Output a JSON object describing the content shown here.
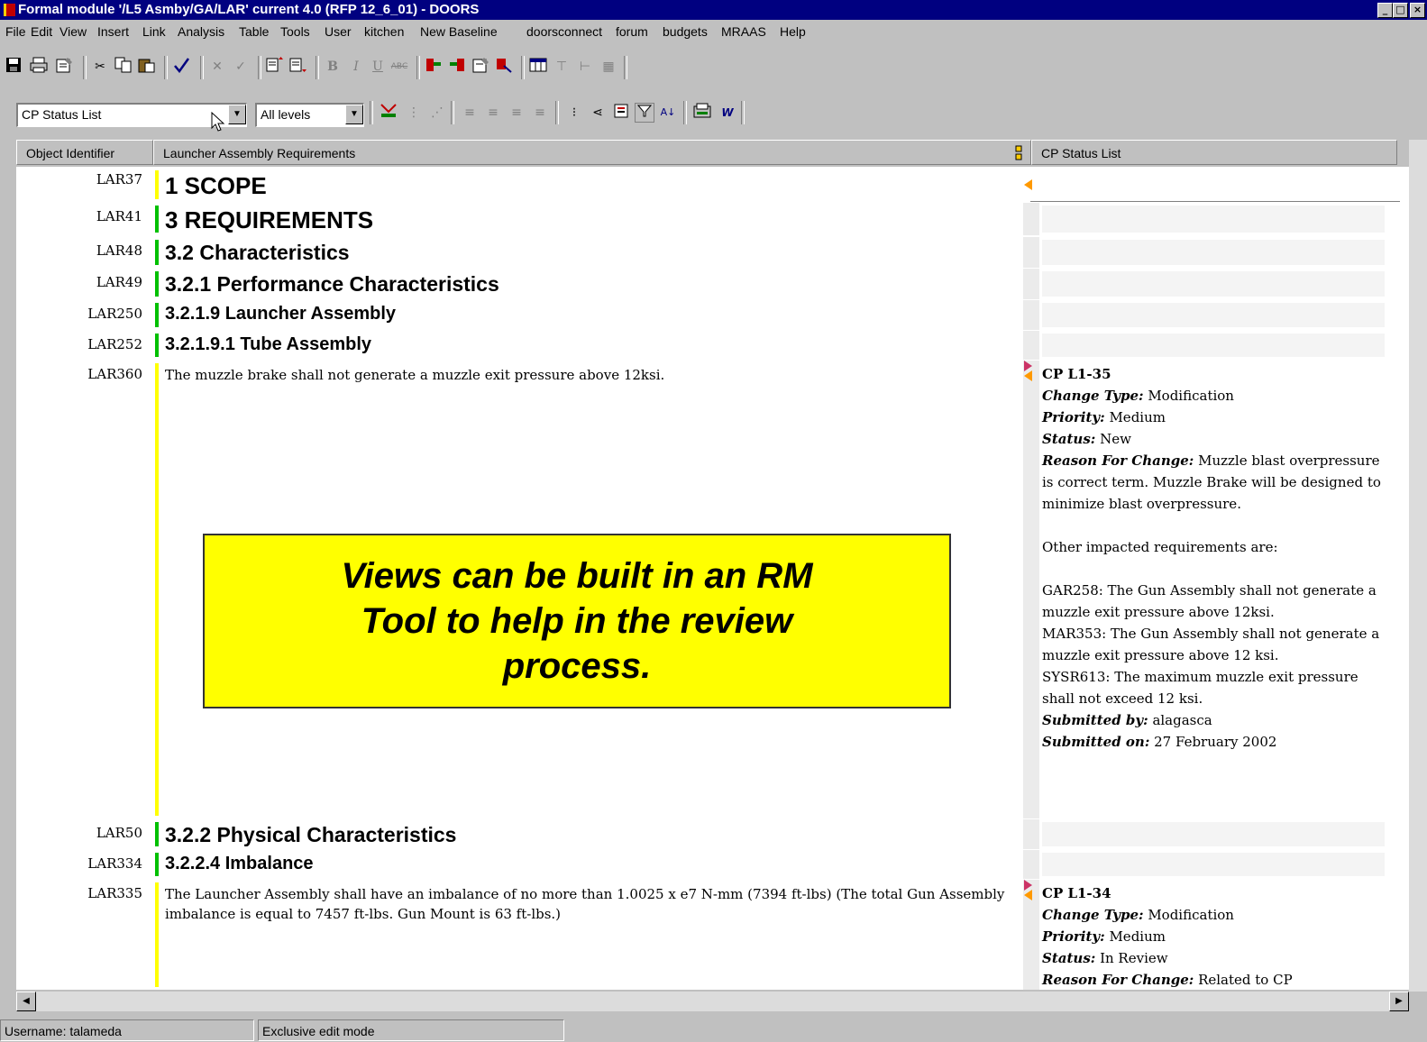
{
  "window": {
    "title": "Formal module '/L5 Asmby/GA/LAR' current 4.0 (RFP 12_6_01) - DOORS",
    "buttons": {
      "minimize": "_",
      "maximize": "□",
      "close": "×"
    }
  },
  "menu": [
    "File",
    "Edit",
    "View",
    "Insert",
    "Link",
    "Analysis",
    "Table",
    "Tools",
    "User",
    "kitchen",
    "New Baseline",
    "doorsconnect",
    "forum",
    "budgets",
    "MRAAS",
    "Help"
  ],
  "toolbar1": {
    "icons": [
      "save-icon",
      "print-icon",
      "properties-icon",
      "cut-icon",
      "copy-icon",
      "paste-icon",
      "spellcheck-icon",
      "delete-icon",
      "accept-icon",
      "insert-above-icon",
      "insert-below-icon",
      "bold-icon",
      "italic-icon",
      "underline-icon",
      "strikethrough-icon",
      "link-start-icon",
      "link-end-icon",
      "module-properties-icon",
      "link-icon",
      "table-icon",
      "table-insert-icon",
      "table-col-icon",
      "table-grid-icon"
    ],
    "bold_glyph": "B",
    "italic_glyph": "I",
    "underline_glyph": "U",
    "strike_glyph": "ABC"
  },
  "toolbar2": {
    "view_select": "CP Status List",
    "level_select": "All levels"
  },
  "columns": {
    "id": "Object Identifier",
    "main": "Launcher Assembly Requirements",
    "cp": "CP Status List"
  },
  "rows": [
    {
      "id": "LAR37",
      "text": "1 SCOPE",
      "style": "h1"
    },
    {
      "id": "LAR41",
      "text": "3 REQUIREMENTS",
      "style": "h1"
    },
    {
      "id": "LAR48",
      "text": "3.2 Characteristics",
      "style": "h2"
    },
    {
      "id": "LAR49",
      "text": "3.2.1 Performance Characteristics",
      "style": "h2"
    },
    {
      "id": "LAR250",
      "text": "3.2.1.9 Launcher Assembly",
      "style": "h3"
    },
    {
      "id": "LAR252",
      "text": "3.2.1.9.1 Tube Assembly",
      "style": "h3"
    },
    {
      "id": "LAR360",
      "text": "The muzzle brake shall not generate a muzzle exit pressure above 12ksi.",
      "style": "body"
    },
    {
      "id": "LAR50",
      "text": "3.2.2 Physical Characteristics",
      "style": "h2"
    },
    {
      "id": "LAR334",
      "text": "3.2.2.4 Imbalance",
      "style": "h3"
    },
    {
      "id": "LAR335",
      "text": "The Launcher Assembly shall have an imbalance of no more than 1.0025  x e7 N-mm (7394 ft-lbs) (The total Gun Assembly imbalance is equal to 7457 ft-lbs. Gun Mount is 63 ft-lbs.)",
      "style": "body"
    }
  ],
  "cp1": {
    "title": "CP L1-35",
    "change_type_label": "Change Type:",
    "change_type": "Modification",
    "priority_label": "Priority:",
    "priority": "Medium",
    "status_label": "Status:",
    "status": "New",
    "reason_label": "Reason For Change:",
    "reason": "Muzzle blast overpressure is correct term.  Muzzle Brake will be designed to minimize blast overpressure.",
    "impacted": "Other impacted requirements are:",
    "imp1": "GAR258:  The Gun Assembly shall not generate a muzzle exit pressure above 12ksi.",
    "imp2": "MAR353:  The Gun Assembly shall not generate a muzzle exit pressure above 12 ksi.",
    "imp3": "SYSR613:  The maximum muzzle exit pressure shall not exceed 12 ksi.",
    "submitted_by_label": "Submitted by:",
    "submitted_by": "alagasca",
    "submitted_on_label": "Submitted on:",
    "submitted_on": "27 February 2002"
  },
  "cp2": {
    "title": "CP L1-34",
    "change_type_label": "Change Type:",
    "change_type": "Modification",
    "priority_label": "Priority:",
    "priority": "Medium",
    "status_label": "Status:",
    "status": "In Review",
    "reason_label": "Reason For Change:",
    "reason": "Related to CP"
  },
  "overlay": {
    "line1": "Views can be built in an RM",
    "line2": "Tool  to help in the review",
    "line3": "process."
  },
  "status": {
    "user": "Username: talameda",
    "mode": "Exclusive edit mode"
  },
  "colors": {
    "titlebar": "#000080",
    "heading_bar": "#00c000",
    "body_bar": "#ffff00",
    "overlay": "#ffff00",
    "marker_orange": "#ff9900",
    "marker_red": "#cc3366"
  }
}
